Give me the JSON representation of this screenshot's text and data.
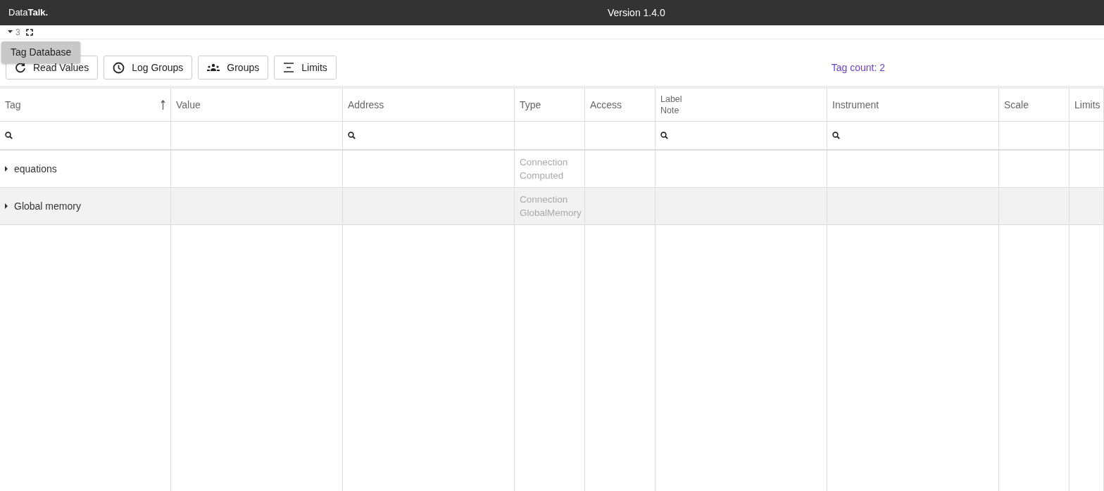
{
  "app": {
    "logo_light": "Data",
    "logo_bold": "Talk.",
    "version": "Version 1.4.0"
  },
  "subbar": {
    "count": "3",
    "expanded": true
  },
  "tooltip": "Tag Database",
  "buttons": [
    {
      "kind": "refresh",
      "label": "Read Values"
    },
    {
      "kind": "clock",
      "label": "Log Groups"
    },
    {
      "kind": "people",
      "label": "Groups"
    },
    {
      "kind": "limits",
      "label": "Limits"
    }
  ],
  "tag_count": "Tag count: 2",
  "table": {
    "columns": [
      {
        "lines": [
          "Tag"
        ],
        "sorted_ascending": true,
        "filter": true
      },
      {
        "lines": [
          "Value"
        ],
        "filter": false
      },
      {
        "lines": [
          "Address"
        ],
        "filter": true
      },
      {
        "lines": [
          "Type"
        ],
        "filter": false
      },
      {
        "lines": [
          "Access"
        ],
        "filter": false
      },
      {
        "lines": [
          "Label",
          "Note"
        ],
        "filter": true
      },
      {
        "lines": [
          "Instrument"
        ],
        "filter": true
      },
      {
        "lines": [
          "Scale"
        ],
        "filter": false
      },
      {
        "lines": [
          "Limits"
        ],
        "filter": false
      }
    ],
    "rows": [
      {
        "tag": "equations",
        "expanded": false,
        "type": [
          "Connection",
          "Computed"
        ],
        "highlighted": false
      },
      {
        "tag": "Global memory",
        "expanded": false,
        "type": [
          "Connection",
          "GlobalMemory"
        ],
        "highlighted": true
      }
    ]
  }
}
